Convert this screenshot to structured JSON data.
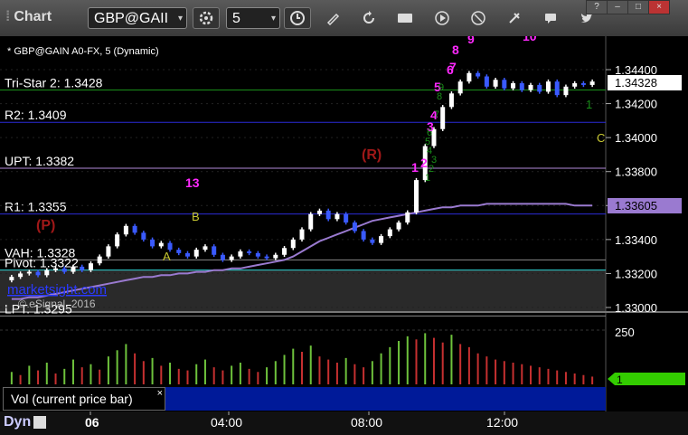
{
  "app": {
    "title": "Chart",
    "window_controls": [
      "?",
      "–",
      "□",
      "×"
    ]
  },
  "toolbar": {
    "symbol": "GBP@GAII",
    "interval": "5",
    "icons": [
      "gear-icon",
      "clock-icon",
      "pencil-icon",
      "refresh-icon",
      "get-icon",
      "play-icon",
      "alert-icon",
      "tools-icon",
      "comment-icon",
      "twitter-icon"
    ]
  },
  "chart_header": "* GBP@GAIN A0-FX, 5 (Dynamic)",
  "watermark": {
    "site": "marketsight.com",
    "copyright": "© eSignal, 2016"
  },
  "price_axis": {
    "ticks": [
      "1.34400",
      "1.34200",
      "1.34000",
      "1.33800",
      "1.33600",
      "1.33400",
      "1.33200",
      "1.33000"
    ],
    "current_price": "1.34328",
    "ma_value": "1.33605"
  },
  "time_axis": {
    "ticks": [
      "06",
      "04:00",
      "08:00",
      "12:00"
    ]
  },
  "levels": [
    {
      "label": "Tri-Star 2: 1.3428",
      "price": 1.3428,
      "color": "#1a8f1a"
    },
    {
      "label": "R2: 1.3409",
      "price": 1.3409,
      "color": "#2b2bd8"
    },
    {
      "label": "UPT: 1.3382",
      "price": 1.3382,
      "color": "#b08ad8"
    },
    {
      "label": "R1: 1.3355",
      "price": 1.3355,
      "color": "#2b2bd8"
    },
    {
      "label": "VAH: 1.3328",
      "price": 1.3328,
      "color": "#888888"
    },
    {
      "label": "Pivot: 1.3322",
      "price": 1.3322,
      "color": "#2ad0d0"
    },
    {
      "label": "LPT: 1.3295",
      "price": 1.3295,
      "color": "#888888"
    }
  ],
  "annotations": {
    "r_marker": "(R)",
    "p_marker": "(P)",
    "letter_a": "A",
    "letter_b": "B",
    "letter_c": "C",
    "edge_count": "1",
    "pink_numbers": [
      "1",
      "2",
      "3",
      "4",
      "5",
      "6",
      "7",
      "8",
      "9",
      "10",
      "13"
    ],
    "green_counts": [
      "1",
      "2",
      "3",
      "4",
      "5",
      "6",
      "7",
      "8",
      "9"
    ]
  },
  "volume_panel": {
    "tab_label": "Vol (current price bar)",
    "close_label": "×",
    "axis_label": "250",
    "current_value": "1"
  },
  "footer": {
    "label": "Dyn"
  },
  "chart_data": {
    "type": "bar",
    "title": "",
    "x_ticks": [
      "06",
      "04:00",
      "08:00",
      "12:00"
    ],
    "ylim": [
      1.3295,
      1.345
    ],
    "y_ticks": [
      1.344,
      1.342,
      1.34,
      1.338,
      1.336,
      1.334,
      1.332,
      1.33
    ],
    "series": [
      {
        "name": "",
        "close": [
          1.3318,
          1.332,
          1.3321,
          1.3319,
          1.3322,
          1.3323,
          1.3321,
          1.3324,
          1.3322,
          1.3326,
          1.333,
          1.3336,
          1.3343,
          1.3348,
          1.3344,
          1.334,
          1.3336,
          1.3338,
          1.3334,
          1.3332,
          1.333,
          1.3334,
          1.3336,
          1.3331,
          1.3328,
          1.333,
          1.3333,
          1.3332,
          1.333,
          1.3329,
          1.3331,
          1.3335,
          1.334,
          1.3346,
          1.3355,
          1.3357,
          1.3352,
          1.3355,
          1.335,
          1.3345,
          1.334,
          1.3338,
          1.3342,
          1.3346,
          1.335,
          1.3356,
          1.3375,
          1.3395,
          1.3405,
          1.3418,
          1.3426,
          1.3433,
          1.3438,
          1.3436,
          1.343,
          1.3434,
          1.3429,
          1.3432,
          1.3428,
          1.3431,
          1.3427,
          1.3433,
          1.3425,
          1.343,
          1.3432,
          1.3431,
          1.3433
        ]
      },
      {
        "name": "",
        "ma": [
          1.3305,
          1.3305,
          1.3306,
          1.3306,
          1.3307,
          1.3308,
          1.3309,
          1.331,
          1.3311,
          1.3312,
          1.3313,
          1.3314,
          1.3315,
          1.3316,
          1.3317,
          1.3318,
          1.3318,
          1.3319,
          1.3319,
          1.332,
          1.332,
          1.3321,
          1.3321,
          1.3322,
          1.3322,
          1.3323,
          1.3323,
          1.3324,
          1.3325,
          1.3326,
          1.3327,
          1.3328,
          1.333,
          1.3333,
          1.3336,
          1.3339,
          1.3341,
          1.3343,
          1.3345,
          1.3347,
          1.3349,
          1.3351,
          1.3352,
          1.3353,
          1.3354,
          1.3355,
          1.3356,
          1.3357,
          1.3358,
          1.3359,
          1.3359,
          1.336,
          1.336,
          1.336,
          1.3361,
          1.3361,
          1.3361,
          1.3361,
          1.3361,
          1.3361,
          1.3361,
          1.3361,
          1.3361,
          1.3361,
          1.336,
          1.336,
          1.336
        ]
      },
      {
        "name": "",
        "volume": [
          80,
          60,
          120,
          90,
          140,
          70,
          100,
          160,
          110,
          130,
          95,
          180,
          220,
          260,
          200,
          150,
          170,
          120,
          140,
          100,
          90,
          130,
          160,
          110,
          90,
          120,
          140,
          100,
          80,
          110,
          150,
          190,
          230,
          210,
          250,
          180,
          160,
          140,
          170,
          130,
          110,
          150,
          200,
          240,
          280,
          310,
          290,
          330,
          300,
          270,
          320,
          260,
          240,
          200,
          180,
          160,
          150,
          140,
          130,
          120,
          110,
          100,
          90,
          80,
          70,
          60,
          50
        ]
      }
    ]
  }
}
